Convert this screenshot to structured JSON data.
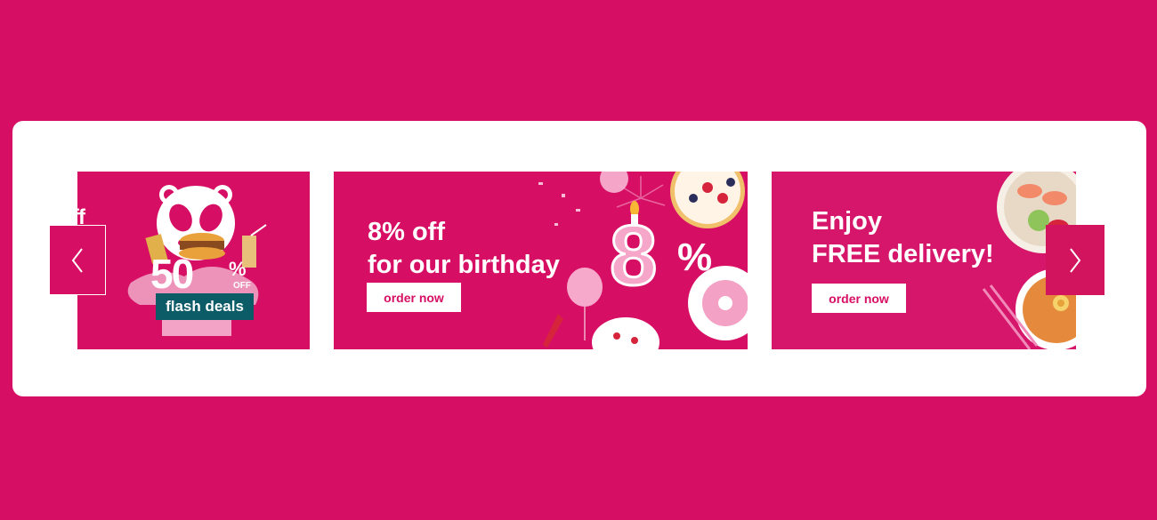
{
  "colors": {
    "brand": "#d70f64",
    "card": "#ffffff"
  },
  "carousel": {
    "prev_icon": "chevron-left-icon",
    "next_icon": "chevron-right-icon",
    "slides": [
      {
        "partial_text": "ff",
        "deal_value": "50",
        "deal_percent": "%",
        "deal_off": "OFF",
        "deal_label": "flash deals",
        "mascot_icon": "panda-icon"
      },
      {
        "headline": "8% off\nfor our birthday",
        "button_label": "order now",
        "big_digit": "8",
        "big_percent": "%"
      },
      {
        "headline": "Enjoy\nFREE delivery!",
        "button_label": "order now"
      }
    ]
  }
}
